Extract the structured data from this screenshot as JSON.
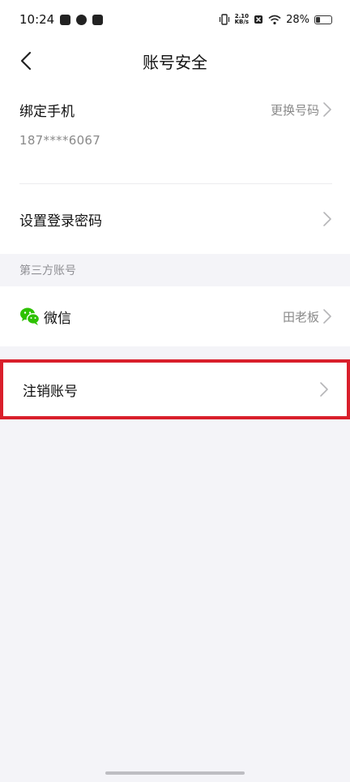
{
  "status_bar": {
    "time": "10:24",
    "net_speed_value": "2.10",
    "net_speed_unit": "KB/s",
    "battery": "28%"
  },
  "header": {
    "title": "账号安全",
    "back_icon": "chevron-left-icon"
  },
  "bind_phone": {
    "label": "绑定手机",
    "action": "更换号码",
    "number": "187****6067"
  },
  "login_password": {
    "label": "设置登录密码"
  },
  "third_party": {
    "section_title": "第三方账号",
    "wechat": {
      "label": "微信",
      "value": "田老板",
      "icon": "wechat-icon",
      "icon_color": "#2dc100"
    }
  },
  "cancel_account": {
    "label": "注销账号",
    "highlight_color": "#d91f2b"
  }
}
